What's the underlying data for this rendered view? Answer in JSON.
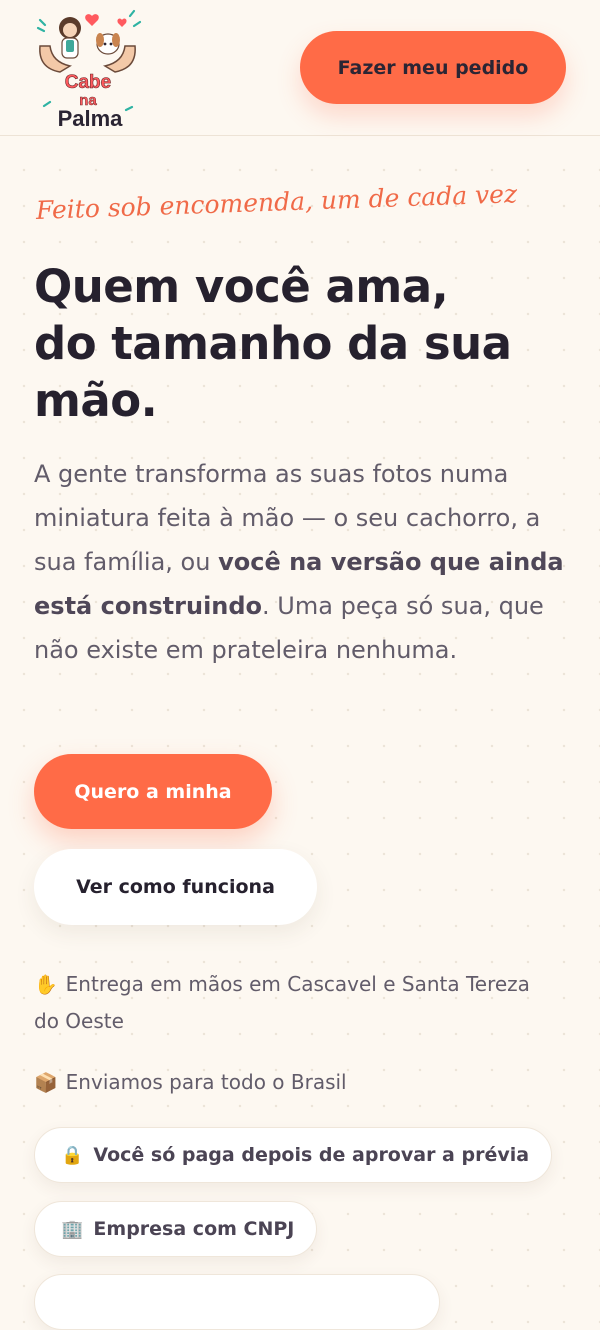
{
  "header": {
    "logo": {
      "text_line1": "Cabe",
      "text_line2": "na",
      "text_line3": "Palma"
    },
    "cta_label": "Fazer meu pedido"
  },
  "hero": {
    "eyebrow": "Feito sob encomenda, um de cada vez",
    "headline_line1": "Quem você ama,",
    "headline_line2": "do tamanho da sua",
    "headline_line3": "mão.",
    "intro_part1": "A gente transforma as suas fotos numa miniatura feita à mão — o seu cachorro, a sua família, ou ",
    "intro_bold": "você na versão que ainda está construindo",
    "intro_part2": ". Uma peça só sua, que não existe em prateleira nenhuma.",
    "primary_button": "Quero a minha",
    "secondary_button": "Ver como funciona"
  },
  "features": [
    {
      "icon": "✋",
      "icon_name": "raised-hand-icon",
      "text": "Entrega em mãos em Cascavel e Santa Tereza do Oeste"
    },
    {
      "icon": "📦",
      "icon_name": "package-icon",
      "text": "Enviamos para todo o Brasil"
    }
  ],
  "trust_pills": [
    {
      "icon": "🔒",
      "icon_name": "lock-icon",
      "text": "Você só paga depois de aprovar a prévia"
    },
    {
      "icon": "🏢",
      "icon_name": "building-icon",
      "text": "Empresa com CNPJ"
    },
    {
      "icon": "",
      "icon_name": "",
      "text": ""
    }
  ],
  "colors": {
    "background": "#fdf8f1",
    "accent": "#ff6b47",
    "accent_text": "#f06a48",
    "heading": "#26212e",
    "body_text": "#625c6a"
  }
}
